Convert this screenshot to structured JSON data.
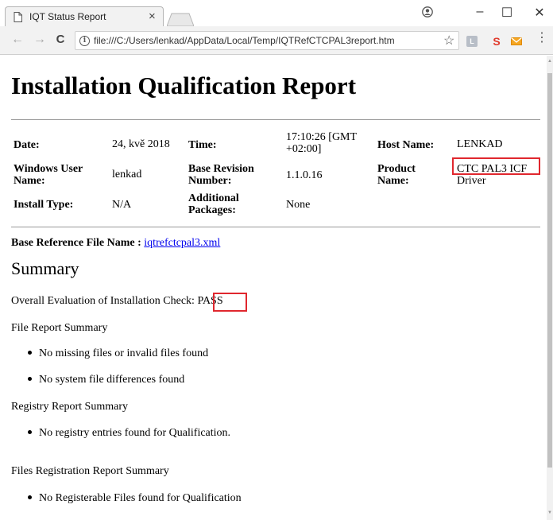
{
  "browser": {
    "tab_title": "IQT Status Report",
    "tab_close": "×",
    "url": "file:///C:/Users/lenkad/AppData/Local/Temp/IQTRefCTCPAL3report.htm",
    "minimize": "–",
    "maximize": "☐",
    "close": "✕",
    "back": "←",
    "forward": "→",
    "reload": "C",
    "star": "☆",
    "menu": "⋮",
    "ext_l": "L",
    "ext_s": "S",
    "info": "i"
  },
  "report": {
    "title": "Installation Qualification Report",
    "date_label": "Date:",
    "date_value": "24, kvě 2018",
    "time_label": "Time:",
    "time_value_1": "17:10:26 [GMT",
    "time_value_2": "+02:00]",
    "host_label": "Host Name:",
    "host_value": "LENKAD",
    "user_label_1": "Windows User",
    "user_label_2": "Name:",
    "user_value": "lenkad",
    "revision_label_1": "Base Revision",
    "revision_label_2": "Number:",
    "revision_value": "1.1.0.16",
    "product_label_1": "Product",
    "product_label_2": "Name:",
    "product_value_1": "CTC PAL3 ICF",
    "product_value_2": "Driver",
    "install_label": "Install Type:",
    "install_value": "N/A",
    "packages_label_1": "Additional",
    "packages_label_2": "Packages:",
    "packages_value": "None",
    "base_ref_label": "Base Reference File Name : ",
    "base_ref_link": "iqtrefctcpal3.xml",
    "summary_heading": "Summary",
    "overall_label": "Overall Evaluation of Installation Check: ",
    "overall_value": "PASS",
    "file_report": "File Report Summary",
    "file_bullet_1": "No missing files or invalid files found",
    "file_bullet_2": "No system file differences found",
    "registry_report": "Registry Report Summary",
    "registry_bullet_1": "No registry entries found for Qualification.",
    "files_reg_report": "Files Registration Report Summary",
    "files_reg_bullet_1": "No Registerable Files found for Qualification"
  },
  "colors": {
    "highlight_box": "#e0272e",
    "link": "#0000ee"
  }
}
